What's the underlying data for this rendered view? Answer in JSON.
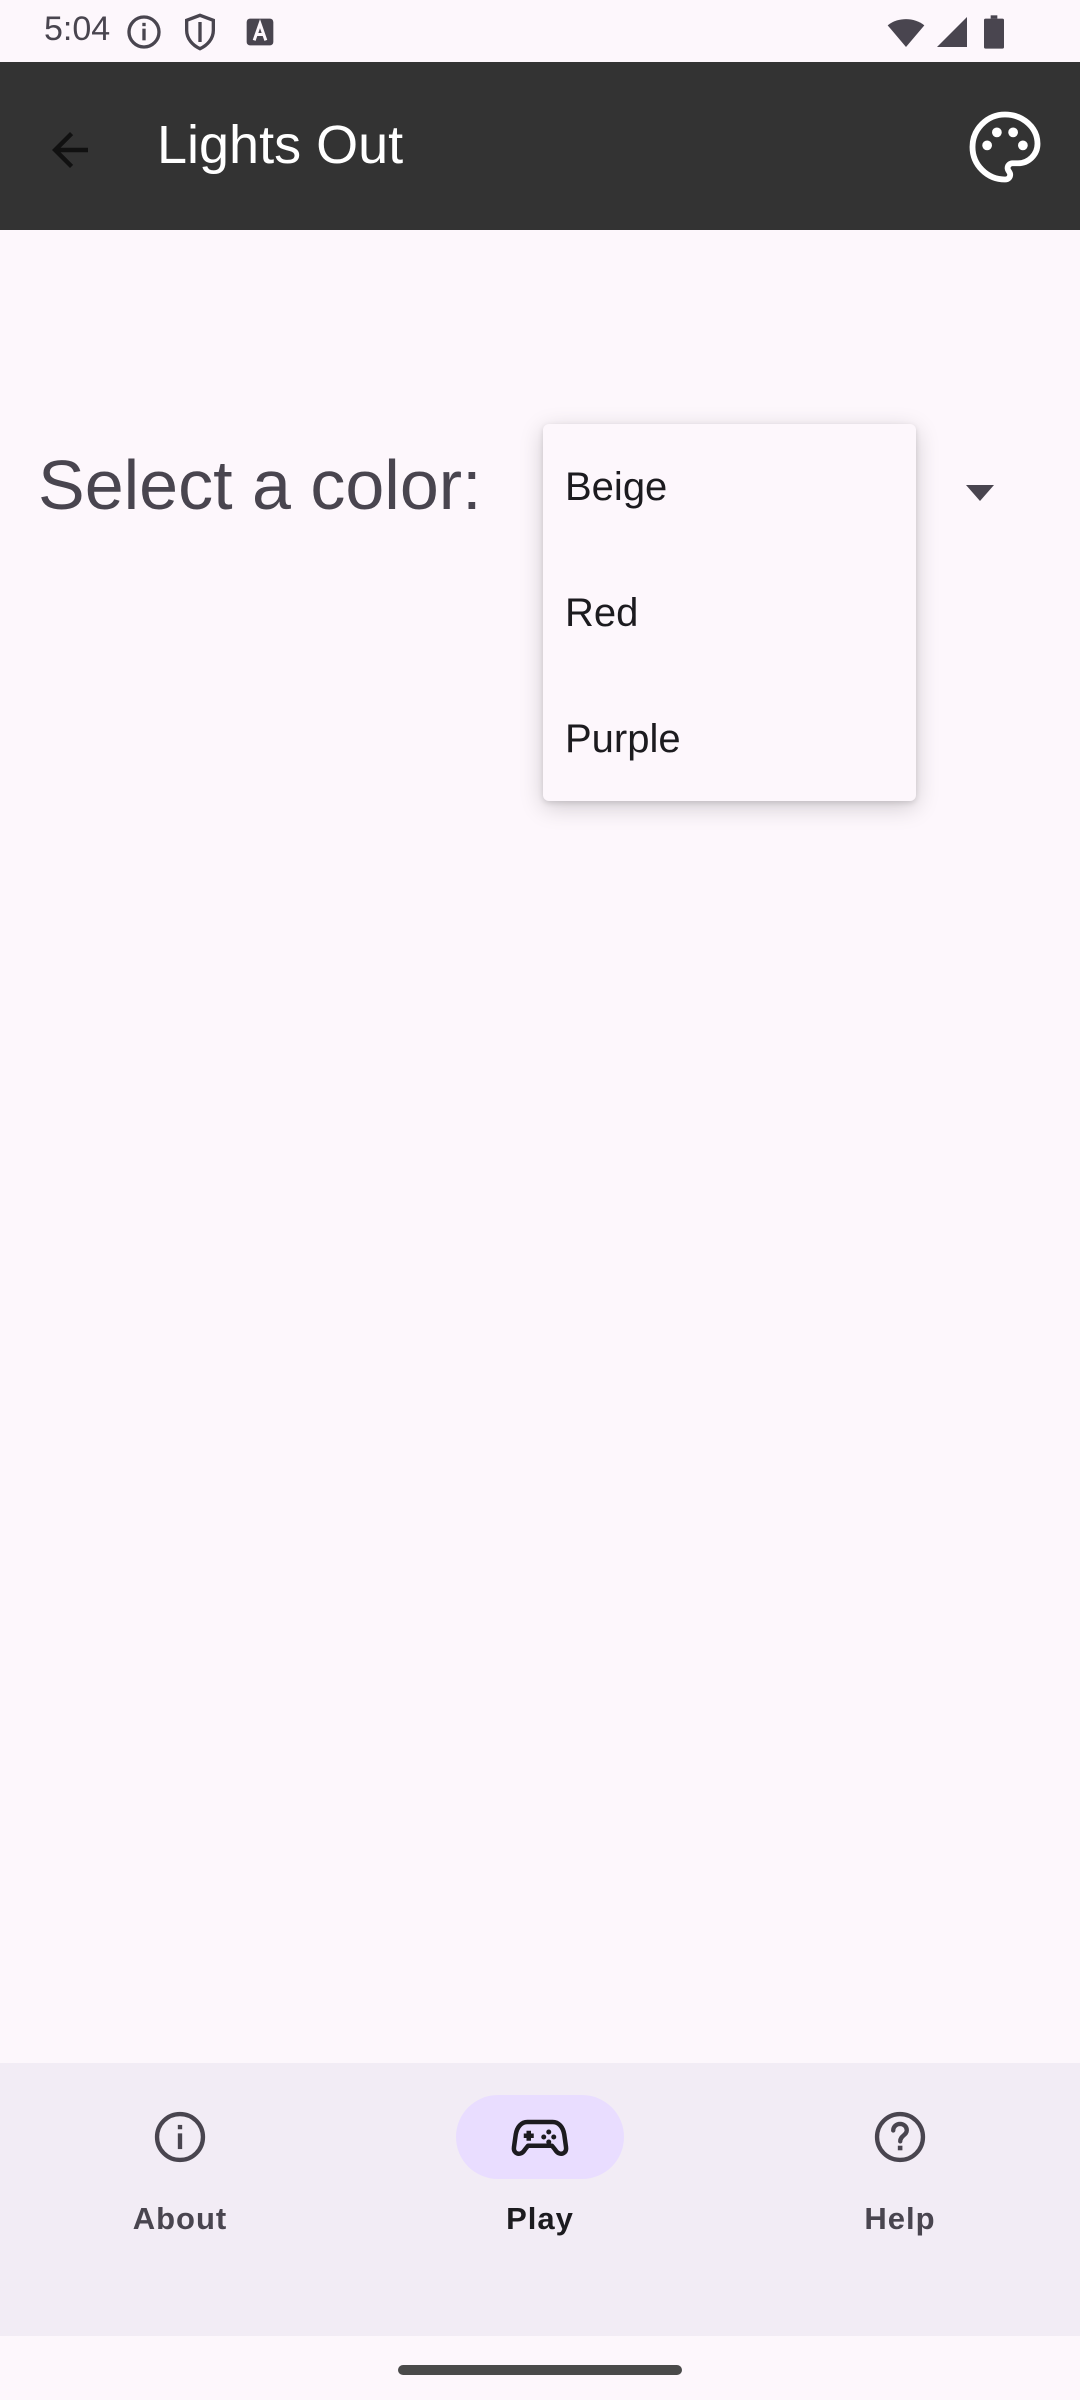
{
  "status_bar": {
    "time": "5:04",
    "icons_left": [
      "info-icon",
      "shield-icon",
      "text-a-icon"
    ],
    "icons_right": [
      "wifi-icon",
      "signal-icon",
      "battery-icon"
    ]
  },
  "app_bar": {
    "title": "Lights Out",
    "background": "#333333",
    "back_icon": "arrow-left-icon",
    "action_icon": "palette-icon"
  },
  "content": {
    "select_label": "Select a color:",
    "dropdown": {
      "expanded": true,
      "options": [
        "Beige",
        "Red",
        "Purple"
      ]
    }
  },
  "bottom_nav": {
    "items": [
      {
        "label": "About",
        "icon": "info-icon",
        "active": false
      },
      {
        "label": "Play",
        "icon": "gamepad-icon",
        "active": true
      },
      {
        "label": "Help",
        "icon": "help-icon",
        "active": false
      }
    ],
    "active_indicator_color": "#E9DDFF",
    "background": "#F2ECF5"
  }
}
